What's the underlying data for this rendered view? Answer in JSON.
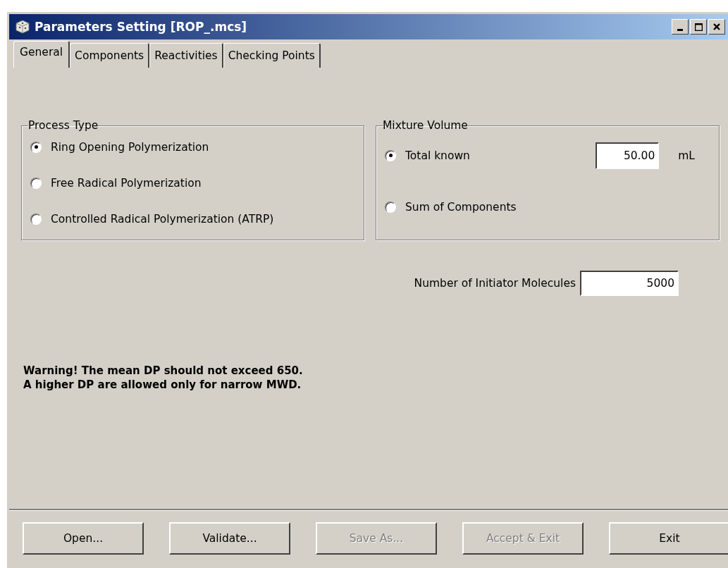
{
  "window": {
    "title": "Parameters Setting [ROP_.mcs]"
  },
  "tabs": [
    {
      "label": "General",
      "selected": true
    },
    {
      "label": "Components",
      "selected": false
    },
    {
      "label": "Reactivities",
      "selected": false
    },
    {
      "label": "Checking Points",
      "selected": false
    }
  ],
  "process_type": {
    "title": "Process Type",
    "options": [
      {
        "label": "Ring Opening Polymerization",
        "selected": true
      },
      {
        "label": "Free Radical Polymerization",
        "selected": false
      },
      {
        "label": "Controlled Radical Polymerization (ATRP)",
        "selected": false
      }
    ]
  },
  "mixture_volume": {
    "title": "Mixture Volume",
    "options": [
      {
        "label": "Total known",
        "selected": true
      },
      {
        "label": "Sum of Components",
        "selected": false
      }
    ],
    "total_value": "50.00",
    "unit": "mL"
  },
  "initiator": {
    "label": "Number of Initiator Molecules",
    "value": "5000"
  },
  "warning": [
    "Warning! The mean DP should not exceed 650.",
    "A higher DP are allowed only for narrow MWD."
  ],
  "buttons": [
    {
      "label": "Open...",
      "disabled": false
    },
    {
      "label": "Validate...",
      "disabled": false
    },
    {
      "label": "Save As...",
      "disabled": true
    },
    {
      "label": "Accept & Exit",
      "disabled": true
    },
    {
      "label": "Exit",
      "disabled": false
    }
  ]
}
